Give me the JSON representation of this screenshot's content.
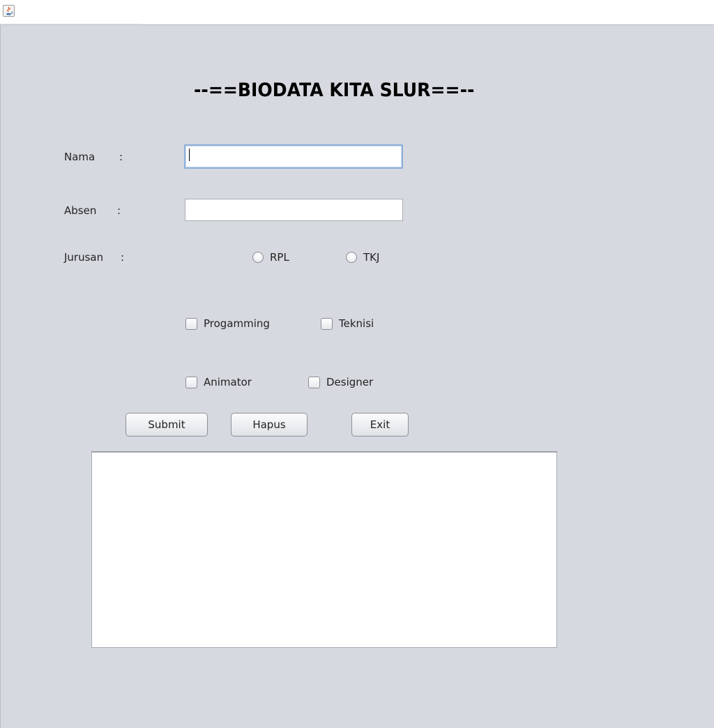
{
  "window": {
    "icon": "java-cup-icon"
  },
  "form": {
    "title": "--==BIODATA KITA SLUR==--",
    "nama_label": "Nama",
    "absen_label": "Absen",
    "jurusan_label": "Jurusan",
    "colon": ":",
    "nama_value": "",
    "absen_value": "",
    "radio_rpl": "RPL",
    "radio_tkj": "TKJ",
    "check_progamming": "Progamming",
    "check_teknisi": "Teknisi",
    "check_animator": "Animator",
    "check_designer": "Designer",
    "submit_label": "Submit",
    "hapus_label": "Hapus",
    "exit_label": "Exit",
    "output_text": ""
  }
}
